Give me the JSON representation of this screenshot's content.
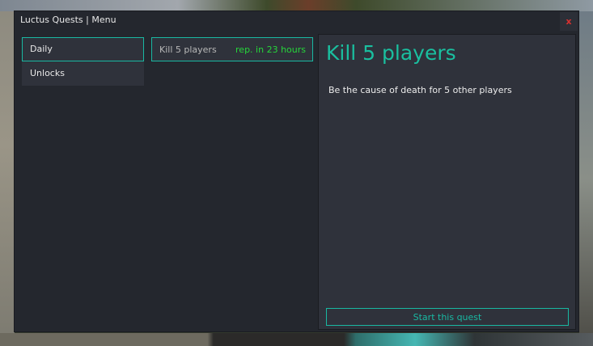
{
  "window": {
    "title": "Luctus Quests | Menu",
    "close_label": "x"
  },
  "sidebar": {
    "items": [
      {
        "label": "Daily",
        "active": true
      },
      {
        "label": "Unlocks",
        "active": false
      }
    ]
  },
  "quest_list": {
    "items": [
      {
        "name": "Kill 5 players",
        "timer": "rep. in 23 hours"
      }
    ]
  },
  "detail": {
    "title": "Kill 5 players",
    "description": "Be the cause of death for 5 other players",
    "start_label": "Start this quest"
  },
  "colors": {
    "accent": "#19b8a2",
    "timer_green": "#25d63a",
    "close_red": "#d83030",
    "panel_bg": "#24272e",
    "item_bg": "#2f323b"
  }
}
